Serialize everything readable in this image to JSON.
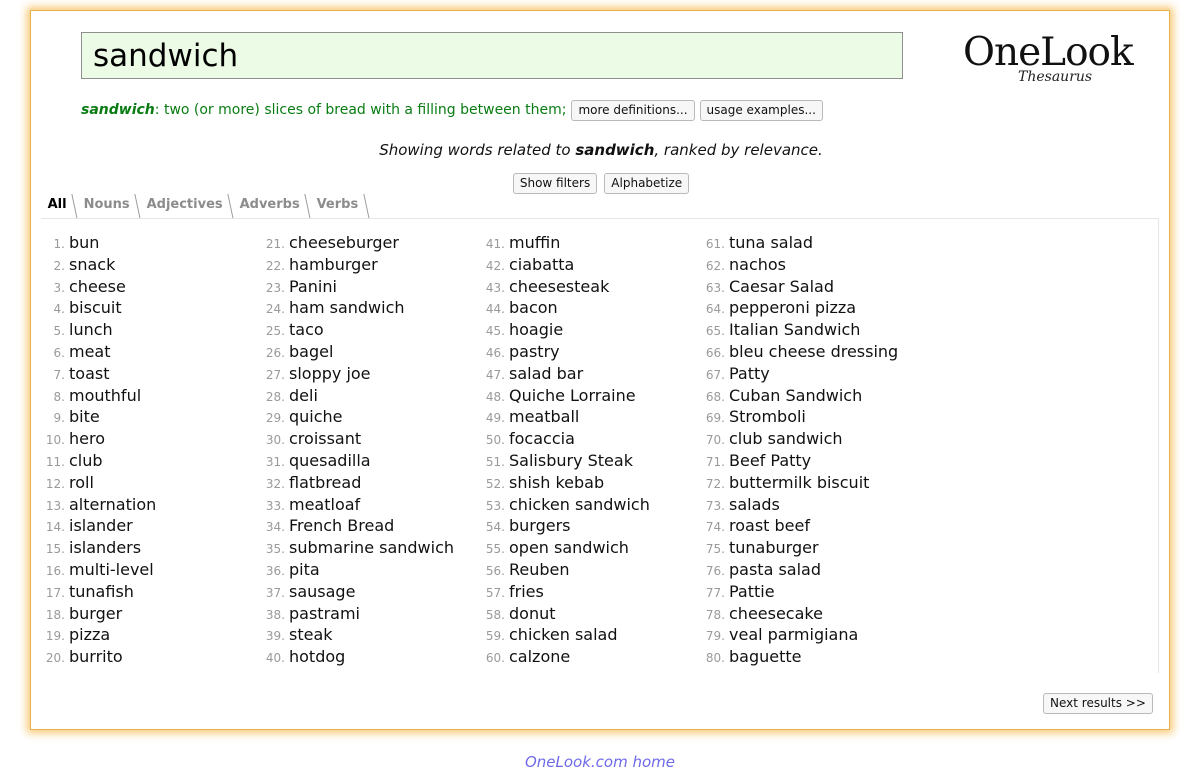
{
  "search": {
    "value": "sandwich"
  },
  "logo": {
    "main": "OneLook",
    "sub": "Thesaurus"
  },
  "definition": {
    "word": "sandwich",
    "text": ": two (or more) slices of bread with a filling between them;",
    "more_label": "more definitions...",
    "usage_label": "usage examples..."
  },
  "showing": {
    "prefix": "Showing words related to ",
    "term": "sandwich",
    "suffix": ", ranked by relevance."
  },
  "filters": {
    "show_label": "Show filters",
    "alpha_label": "Alphabetize"
  },
  "tabs": [
    "All",
    "Nouns",
    "Adjectives",
    "Adverbs",
    "Verbs"
  ],
  "results": [
    [
      "bun",
      "snack",
      "cheese",
      "biscuit",
      "lunch",
      "meat",
      "toast",
      "mouthful",
      "bite",
      "hero",
      "club",
      "roll",
      "alternation",
      "islander",
      "islanders",
      "multi-level",
      "tunafish",
      "burger",
      "pizza",
      "burrito"
    ],
    [
      "cheeseburger",
      "hamburger",
      "Panini",
      "ham sandwich",
      "taco",
      "bagel",
      "sloppy joe",
      "deli",
      "quiche",
      "croissant",
      "quesadilla",
      "flatbread",
      "meatloaf",
      "French Bread",
      "submarine sandwich",
      "pita",
      "sausage",
      "pastrami",
      "steak",
      "hotdog"
    ],
    [
      "muffin",
      "ciabatta",
      "cheesesteak",
      "bacon",
      "hoagie",
      "pastry",
      "salad bar",
      "Quiche Lorraine",
      "meatball",
      "focaccia",
      "Salisbury Steak",
      "shish kebab",
      "chicken sandwich",
      "burgers",
      "open sandwich",
      "Reuben",
      "fries",
      "donut",
      "chicken salad",
      "calzone"
    ],
    [
      "tuna salad",
      "nachos",
      "Caesar Salad",
      "pepperoni pizza",
      "Italian Sandwich",
      "bleu cheese dressing",
      "Patty",
      "Cuban Sandwich",
      "Stromboli",
      "club sandwich",
      "Beef Patty",
      "buttermilk biscuit",
      "salads",
      "roast beef",
      "tunaburger",
      "pasta salad",
      "Pattie",
      "cheesecake",
      "veal parmigiana",
      "baguette"
    ]
  ],
  "next_label": "Next results >>",
  "footer": {
    "home_label": "OneLook.com home"
  }
}
